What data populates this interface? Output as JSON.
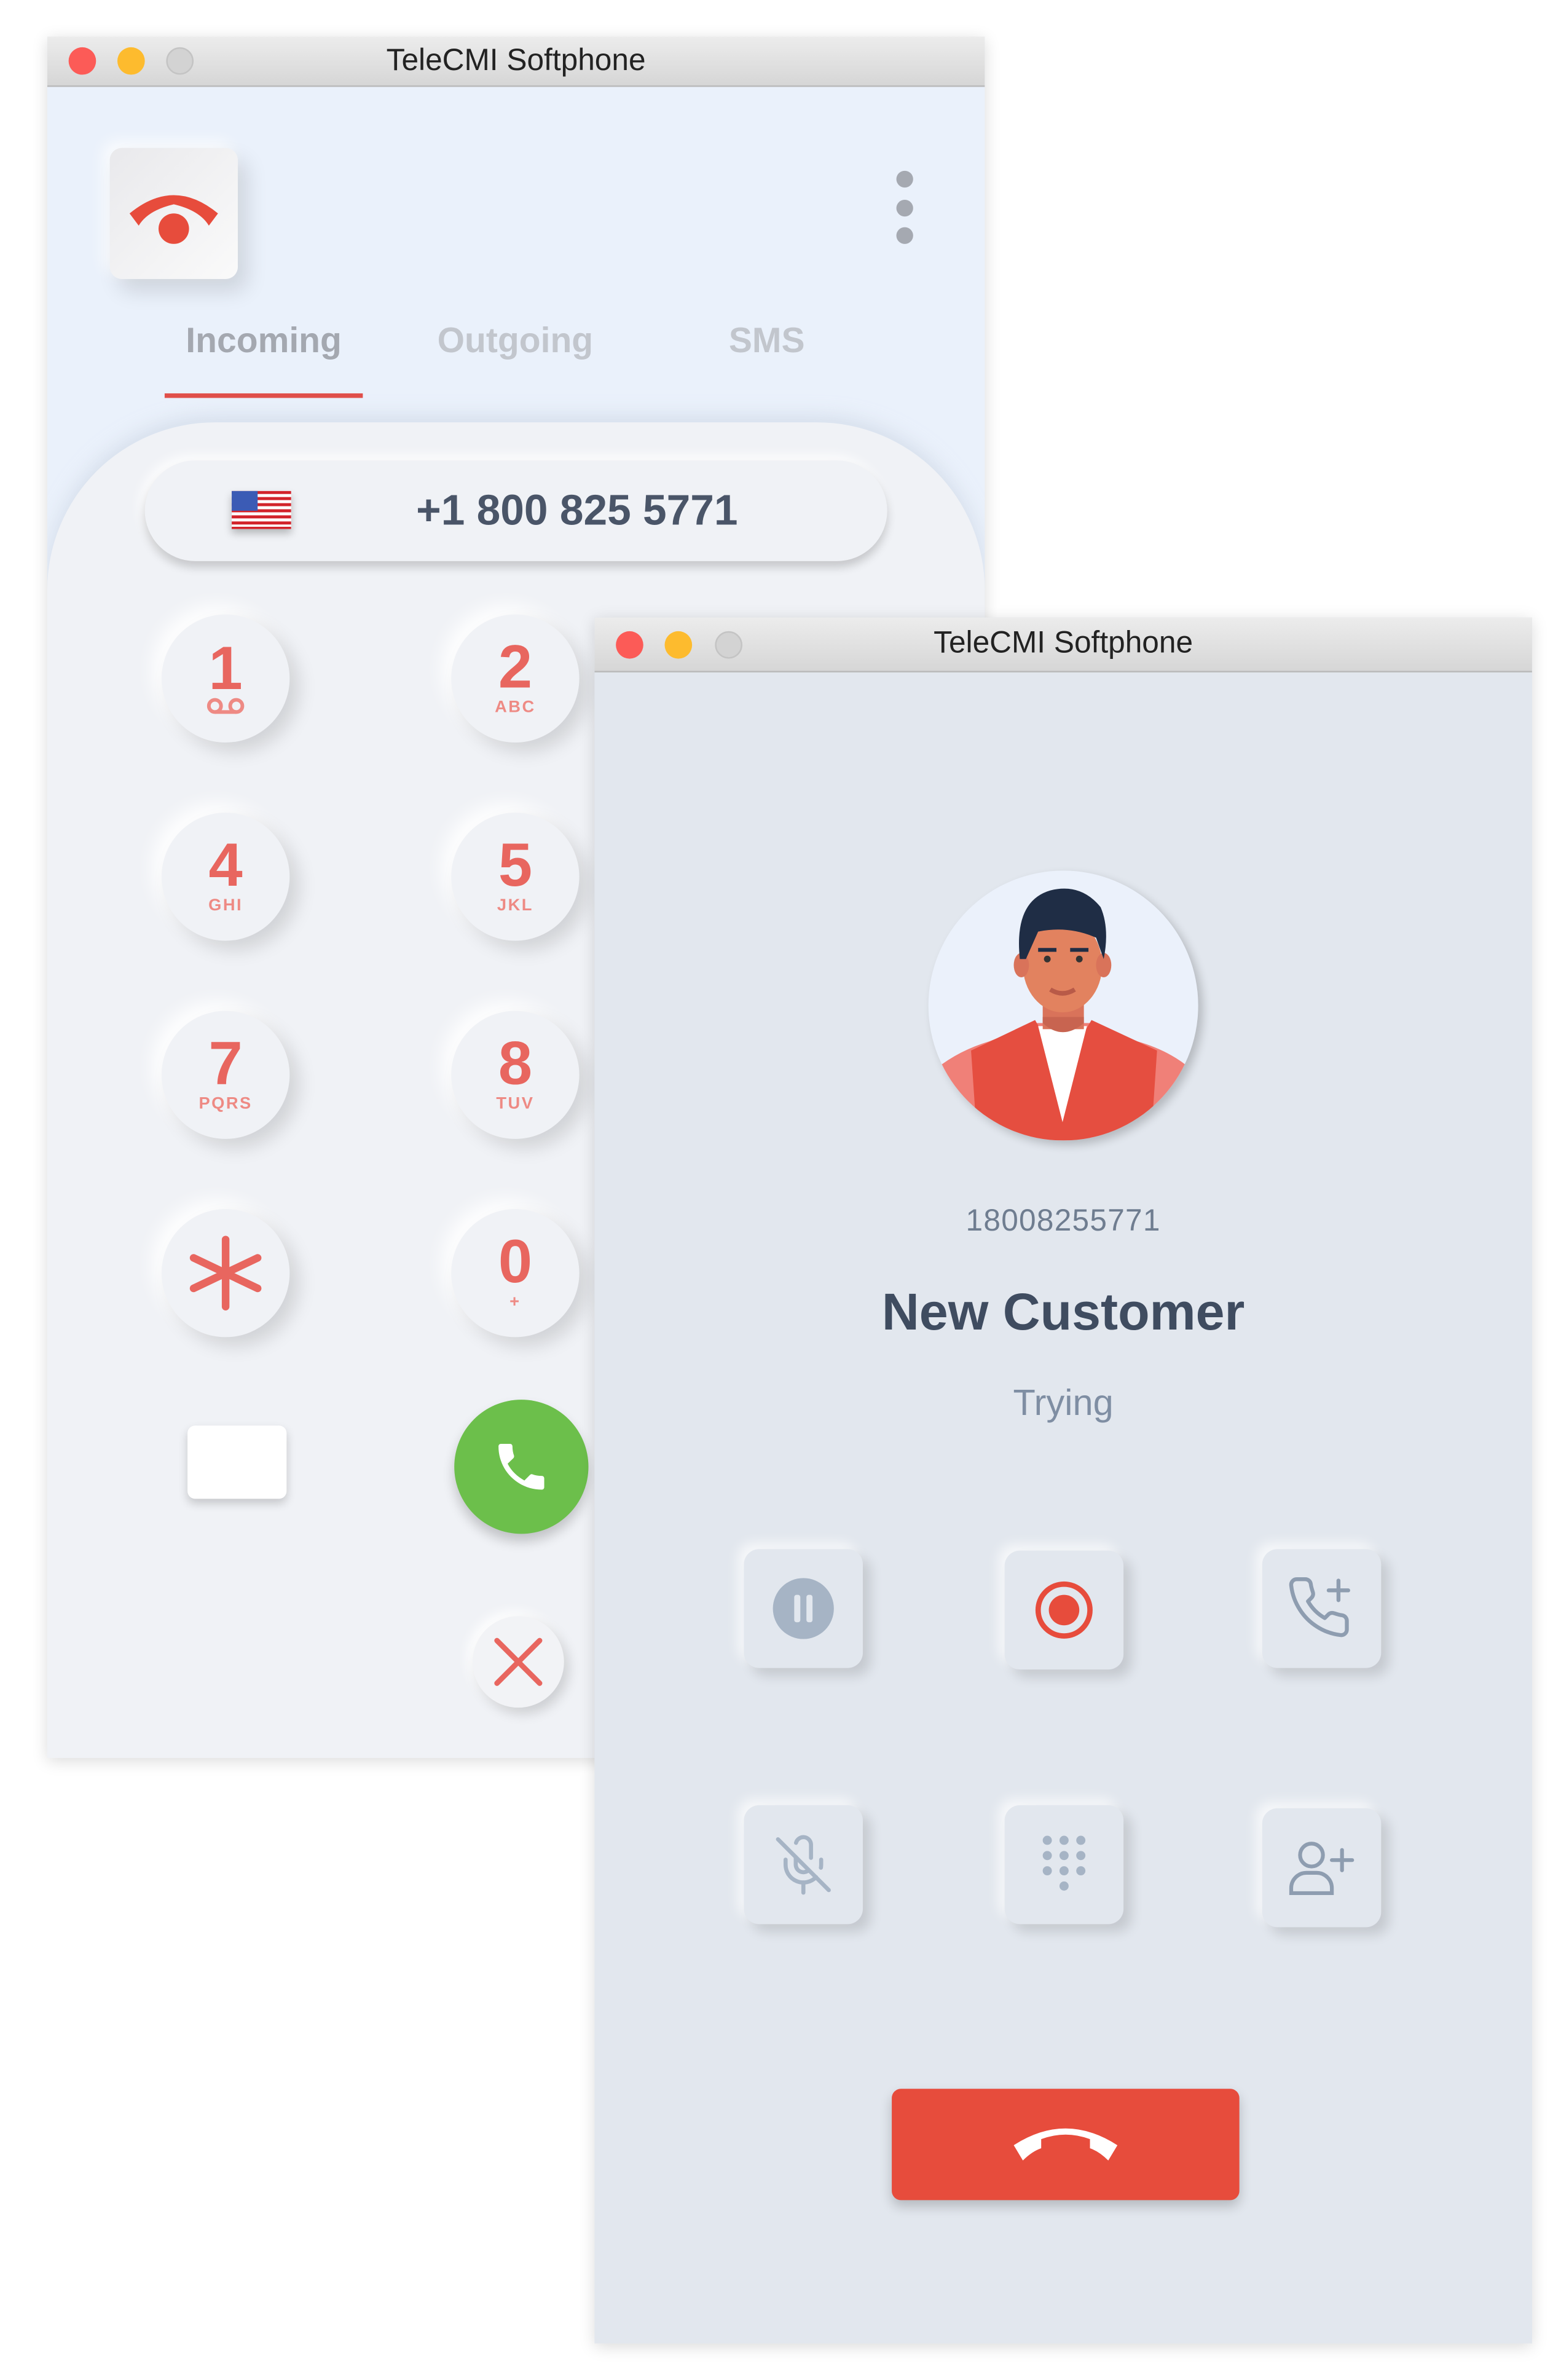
{
  "colors": {
    "accent": "#e74c3c",
    "call_green": "#6cbf4b",
    "digit": "#e8665f",
    "text_dark": "#3f4c60"
  },
  "dialer_window": {
    "title": "TeleCMI Softphone",
    "logo_icon": "phone-hangup-icon",
    "menu_icon": "kebab-menu-icon",
    "tabs": [
      {
        "label": "Incoming",
        "active": true
      },
      {
        "label": "Outgoing",
        "active": false
      },
      {
        "label": "SMS",
        "active": false
      }
    ],
    "phone_input": {
      "country_icon": "us-flag-icon",
      "value": "+1 800 825 5771"
    },
    "keys": [
      {
        "digit": "1",
        "sub": "voicemail-icon"
      },
      {
        "digit": "2",
        "sub": "ABC"
      },
      {
        "digit": "4",
        "sub": "GHI"
      },
      {
        "digit": "5",
        "sub": "JKL"
      },
      {
        "digit": "7",
        "sub": "PQRS"
      },
      {
        "digit": "8",
        "sub": "TUV"
      },
      {
        "digit": "*",
        "sub": ""
      },
      {
        "digit": "0",
        "sub": "+"
      }
    ],
    "call_icon": "phone-icon",
    "clear_icon": "close-icon"
  },
  "call_window": {
    "title": "TeleCMI Softphone",
    "number": "18008255771",
    "name": "New Customer",
    "status": "Trying",
    "controls": [
      "pause-icon",
      "record-icon",
      "add-call-icon",
      "mute-mic-icon",
      "dialpad-icon",
      "add-user-icon"
    ],
    "end_call_icon": "phone-hangup-icon"
  }
}
